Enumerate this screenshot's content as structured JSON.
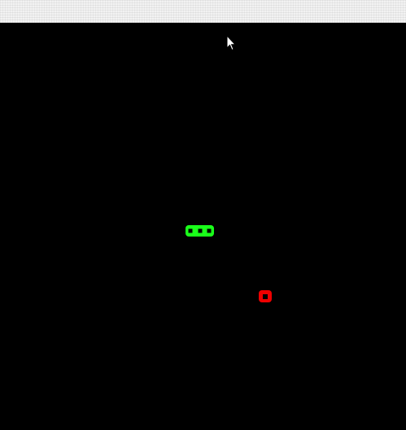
{
  "game": {
    "snake": {
      "color": "#1aff1a",
      "segment_count": 3,
      "direction": "horizontal"
    },
    "food": {
      "color": "#ee0000"
    },
    "board": {
      "background": "#000000"
    }
  },
  "top_strip": {
    "color": "#f2f2f2"
  },
  "cursor": {
    "icon": "mouse-pointer-icon"
  }
}
